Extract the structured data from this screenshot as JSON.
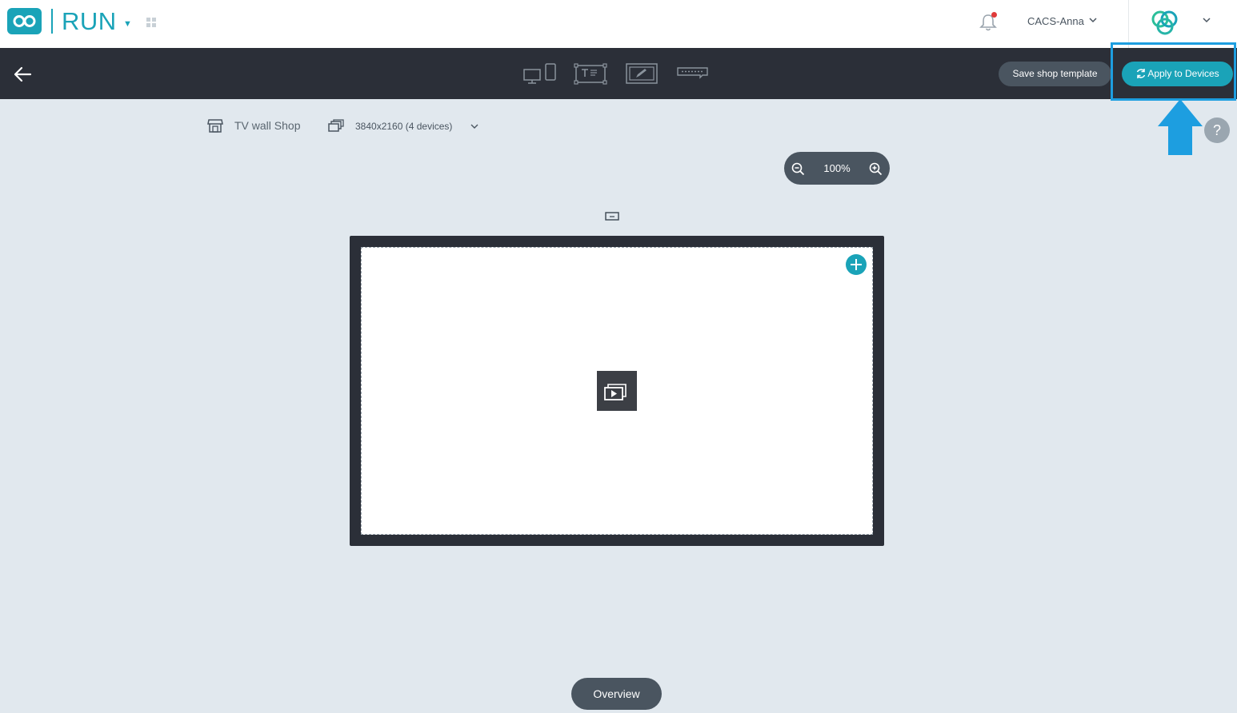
{
  "header": {
    "app_name": "RUN",
    "user_name": "CACS-Anna",
    "icons": [
      "infinity-logo",
      "grid-icon",
      "bell-icon",
      "brand-logo"
    ],
    "notification_dot_color": "#e03a3a"
  },
  "toolbar": {
    "tools": [
      "display-devices-icon",
      "text-layout-icon",
      "edit-screen-icon",
      "ticker-icon"
    ],
    "save_label": "Save shop template",
    "apply_label": "Apply to Devices"
  },
  "info": {
    "shop_name": "TV wall Shop",
    "resolution": "3840x2160 (4 devices)"
  },
  "zoom": {
    "level": "100%"
  },
  "help": {
    "label": "?"
  },
  "footer": {
    "overview_label": "Overview"
  },
  "colors": {
    "accent": "#1aa3b8",
    "dark": "#2b2f38",
    "background": "#e1e8ee",
    "annotation": "#1d9ee0"
  }
}
